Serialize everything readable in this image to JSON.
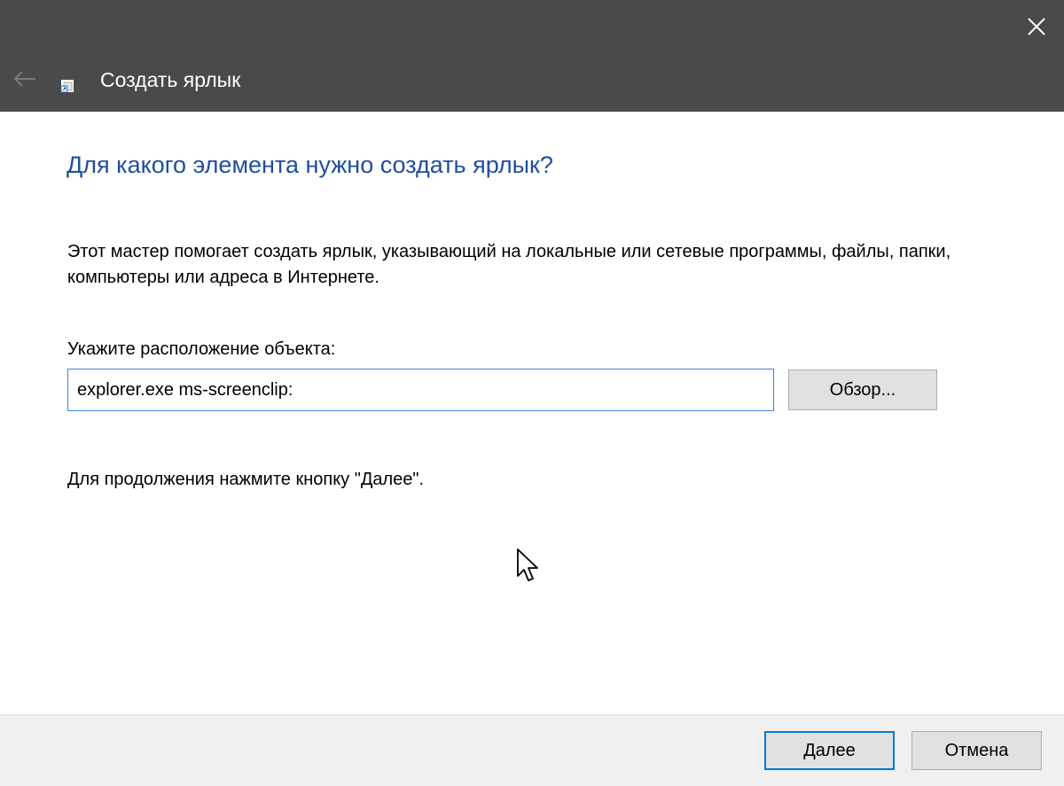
{
  "window": {
    "header_title": "Создать ярлык",
    "colors": {
      "titlebar_bg": "#4a4a4a",
      "title_text": "#ffffff",
      "question_text": "#1f4e9c",
      "focus_border": "#0078d7",
      "button_bg": "#e1e1e1",
      "footer_bg": "#f0f0f0"
    },
    "icons": {
      "close": "close-icon",
      "back": "back-arrow-icon",
      "app": "shortcut-icon"
    }
  },
  "main": {
    "question": "Для какого элемента нужно создать ярлык?",
    "description": "Этот мастер помогает создать ярлык, указывающий на локальные или сетевые программы, файлы, папки, компьютеры или адреса в Интернете.",
    "location_label": "Укажите расположение объекта:",
    "location_value": "explorer.exe ms-screenclip:",
    "browse_label": "Обзор...",
    "continue_hint": "Для продолжения нажмите кнопку \"Далее\"."
  },
  "footer": {
    "next_label": "Далее",
    "cancel_label": "Отмена"
  }
}
